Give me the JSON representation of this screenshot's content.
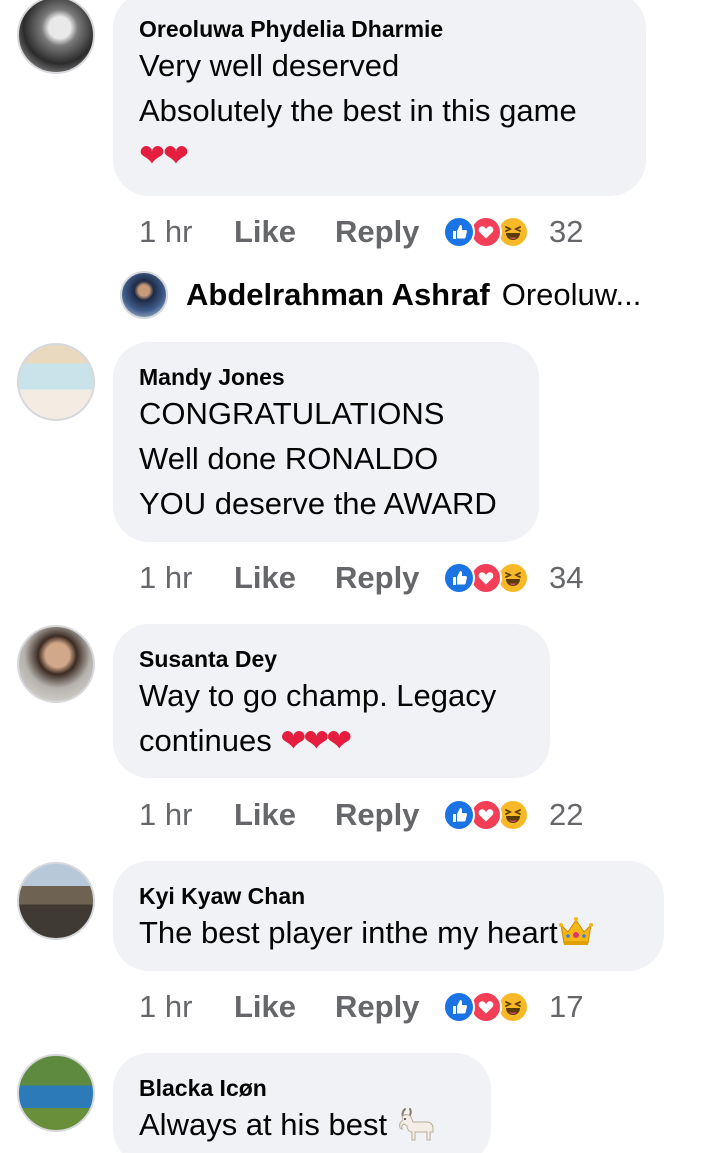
{
  "comments": [
    {
      "name": "Oreoluwa Phydelia Dharmie",
      "lines": [
        "Very well deserved",
        "Absolutely the best in this game"
      ],
      "hearts": "❤❤",
      "time": "1 hr",
      "like": "Like",
      "reply": "Reply",
      "count": "32"
    },
    {
      "name": "Mandy Jones",
      "lines": [
        "CONGRATULATIONS",
        "Well done RONALDO",
        "YOU deserve the AWARD"
      ],
      "time": "1 hr",
      "like": "Like",
      "reply": "Reply",
      "count": "34"
    },
    {
      "name": "Susanta Dey",
      "lines": [
        "Way to go champ. Legacy",
        "continues"
      ],
      "hearts": "❤❤❤",
      "time": "1 hr",
      "like": "Like",
      "reply": "Reply",
      "count": "22"
    },
    {
      "name": "Kyi Kyaw Chan",
      "lines": [
        "The best player inthe my heart"
      ],
      "time": "1 hr",
      "like": "Like",
      "reply": "Reply",
      "count": "17"
    },
    {
      "name": "Blacka Icøn",
      "lines": [
        "Always at his best"
      ]
    }
  ],
  "reply_preview": {
    "name": "Abdelrahman Ashraf",
    "text": "Oreoluw..."
  },
  "colors": {
    "bubble": "#f0f2f5",
    "meta_text": "#65676b",
    "like_blue": "#1b74e4",
    "love_red": "#f33e58",
    "haha_yellow": "#f7b928"
  },
  "icons": [
    "like-reaction-icon",
    "love-reaction-icon",
    "haha-reaction-icon",
    "crown-emoji-icon",
    "goat-emoji-icon"
  ]
}
